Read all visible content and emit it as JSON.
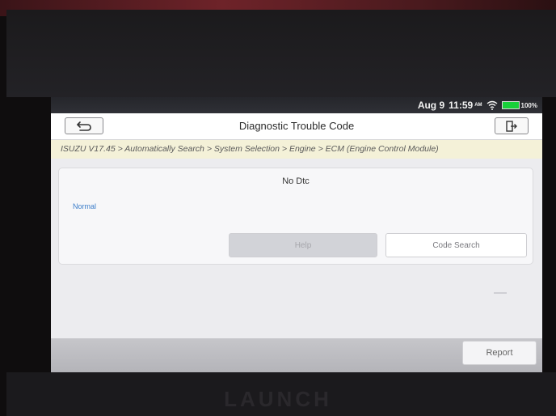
{
  "status_bar": {
    "date": "Aug 9",
    "time": "11:59",
    "ampm": "AM",
    "battery_percent": "100%",
    "battery_level": 1.0,
    "battery_color": "#18d03a"
  },
  "header": {
    "title": "Diagnostic Trouble Code"
  },
  "breadcrumb": "ISUZU V17.45 > Automatically Search > System Selection > Engine > ECM (Engine Control Module)",
  "dtc_panel": {
    "heading": "No Dtc",
    "status": "Normal",
    "help_label": "Help",
    "code_search_label": "Code Search"
  },
  "footer": {
    "report_label": "Report"
  },
  "device": {
    "brand": "LAUNCH"
  },
  "colors": {
    "accent_blue": "#3a7cc9",
    "breadcrumb_bg": "#f4f1d8",
    "statusbar_bg": "#2f3036"
  },
  "icons": {
    "back": "back-arrow-icon",
    "exit": "exit-icon",
    "wifi": "wifi-icon",
    "battery": "battery-icon"
  }
}
